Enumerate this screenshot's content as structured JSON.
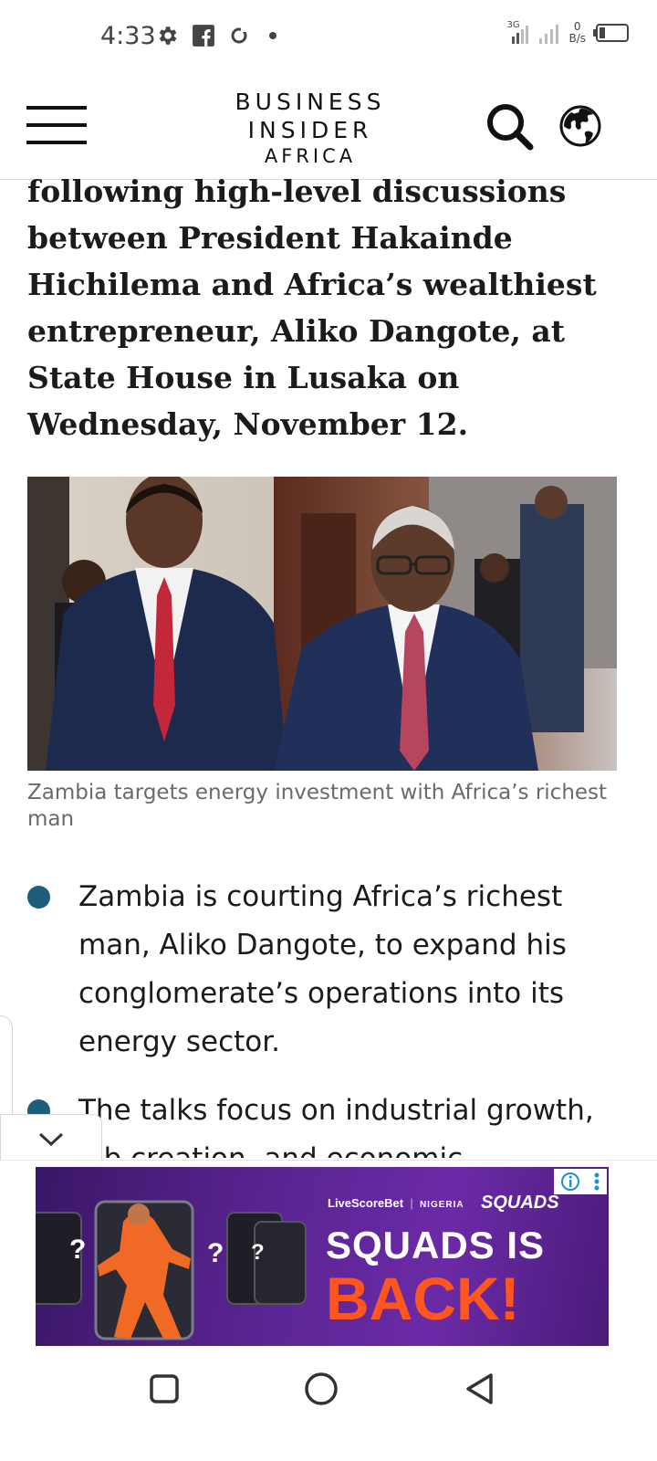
{
  "status_bar": {
    "time": "4:33",
    "icons": [
      "gear-icon",
      "facebook-icon",
      "sync-icon",
      "dot-icon"
    ],
    "network_label": "3G",
    "speed_value": "0",
    "speed_unit": "B/s"
  },
  "header": {
    "logo_line1": "BUSINESS",
    "logo_line2": "INSIDER",
    "logo_line3": "AFRICA",
    "icons": [
      "menu-icon",
      "search-icon",
      "globe-icon"
    ]
  },
  "article": {
    "headline_fragment": "following high-level discussions between President Hakainde Hichilema and Africa’s wealthiest entrepreneur, Aliko Dangote, at State House in Lusaka on Wednesday, November 12.",
    "image_caption": "Zambia targets energy investment with Africa’s richest man",
    "bullets": [
      "Zambia is courting Africa’s richest man, Aliko Dangote, to expand his conglomerate’s operations into its energy sector.",
      "The talks focus on industrial growth, job creation, and economic"
    ]
  },
  "ad": {
    "brand": "LiveScoreBet",
    "region": "NIGERIA",
    "logo_text": "SQUADS",
    "line1": "SQUADS IS",
    "line2": "BACK!",
    "card_mark": "?",
    "icons": [
      "info-icon",
      "more-vertical-icon"
    ]
  },
  "nav_bar": {
    "icons": [
      "square-icon",
      "circle-icon",
      "triangle-back-icon"
    ]
  },
  "colors": {
    "bullet": "#1e5e7c",
    "ad_bg": "#5a2492",
    "ad_accent": "#ff5620"
  }
}
